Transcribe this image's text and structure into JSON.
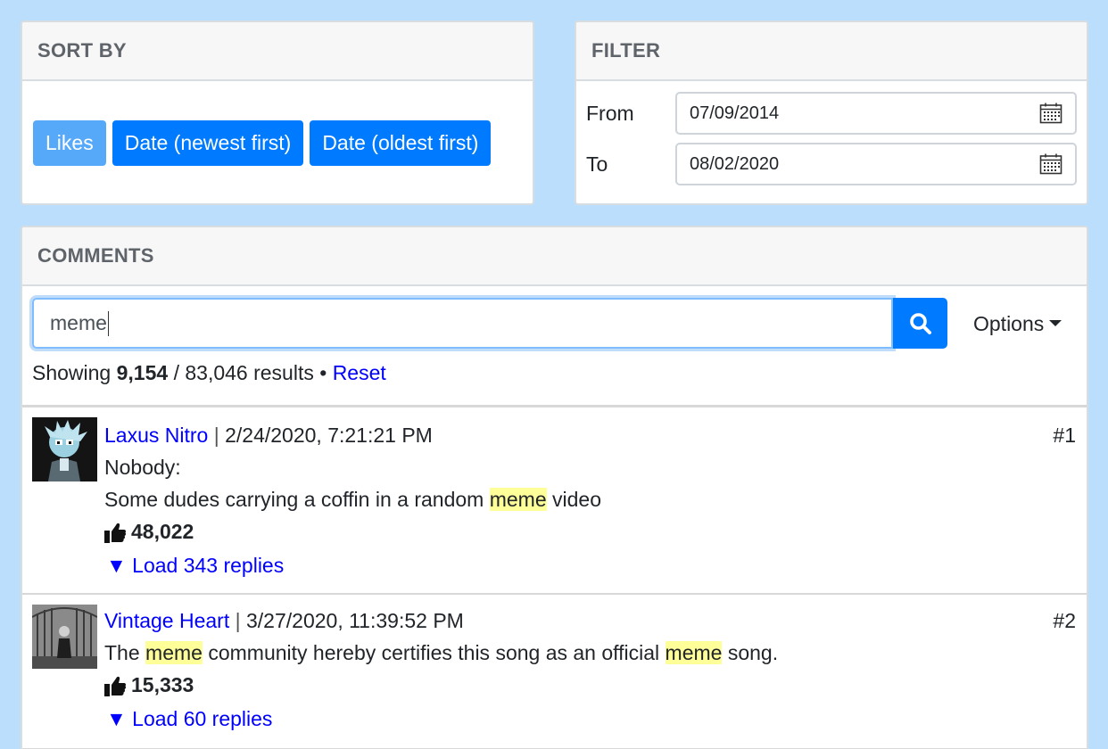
{
  "sort": {
    "header": "SORT BY",
    "buttons": [
      "Likes",
      "Date (newest first)",
      "Date (oldest first)"
    ],
    "active_index": 0
  },
  "filter": {
    "header": "FILTER",
    "from_label": "From",
    "from_value": "07/09/2014",
    "to_label": "To",
    "to_value": "08/02/2020"
  },
  "comments": {
    "header": "COMMENTS",
    "search_value": "meme",
    "options_label": "Options",
    "results": {
      "prefix": "Showing",
      "shown": "9,154",
      "separator": "/",
      "total": "83,046 results",
      "bullet": "•",
      "reset": "Reset"
    },
    "items": [
      {
        "author": "Laxus Nitro",
        "sep": "|",
        "timestamp": "2/24/2020, 7:21:21 PM",
        "number": "#1",
        "line1": "Nobody:",
        "line2_pre": "Some dudes carrying a coffin in a random ",
        "line2_hl": "meme",
        "line2_post": " video",
        "likes": "48,022",
        "replies": "▼ Load 343 replies"
      },
      {
        "author": "Vintage Heart",
        "sep": "|",
        "timestamp": "3/27/2020, 11:39:52 PM",
        "number": "#2",
        "t_pre": "The ",
        "t_hl1": "meme",
        "t_mid": " community hereby certifies this song as an official ",
        "t_hl2": "meme",
        "t_post": " song.",
        "likes": "15,333",
        "replies": "▼ Load 60 replies"
      }
    ]
  },
  "colors": {
    "page_bg": "#bbdefd",
    "primary": "#007bff",
    "primary_active": "#56a9f8",
    "link": "#0000ff",
    "highlight": "#ffff99"
  }
}
